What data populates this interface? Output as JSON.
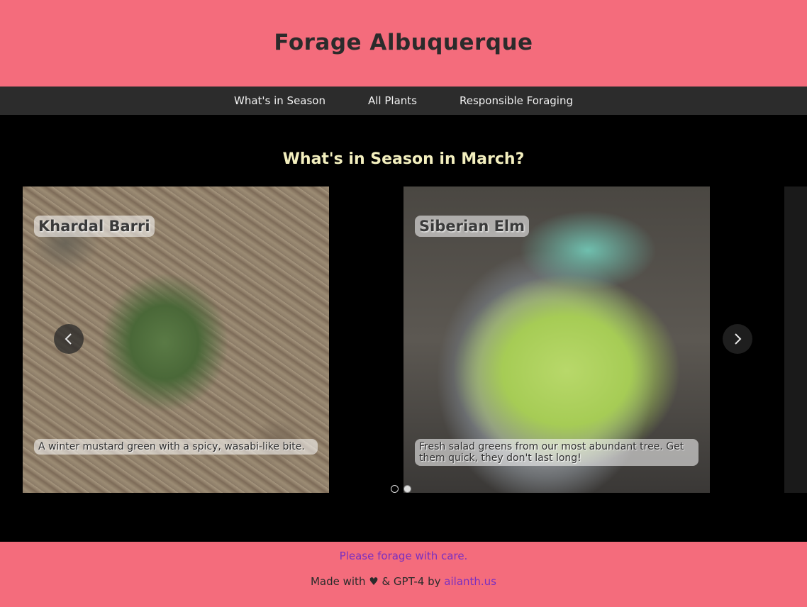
{
  "header": {
    "title": "Forage Albuquerque",
    "background": "#f46c7c"
  },
  "nav": {
    "items": [
      {
        "label": "What's in Season"
      },
      {
        "label": "All Plants"
      },
      {
        "label": "Responsible Foraging"
      }
    ]
  },
  "main": {
    "heading": "What's in Season in March?",
    "carousel": {
      "slides": [
        {
          "title": "Khardal Barri",
          "description": "A winter mustard green with a spicy, wasabi-like bite."
        },
        {
          "title": "Siberian Elm",
          "description": "Fresh salad greens from our most abundant tree. Get them quick, they don't last long!"
        }
      ],
      "active_index": 1,
      "prev_icon": "chevron-left-icon",
      "next_icon": "chevron-right-icon"
    }
  },
  "footer": {
    "care_text": "Please forage with care.",
    "made_with": "Made with",
    "heart_icon": "heart-icon",
    "gpt_by": "& GPT-4 by",
    "author_link": "ailanth.us",
    "accent": "#7a2fc0"
  }
}
